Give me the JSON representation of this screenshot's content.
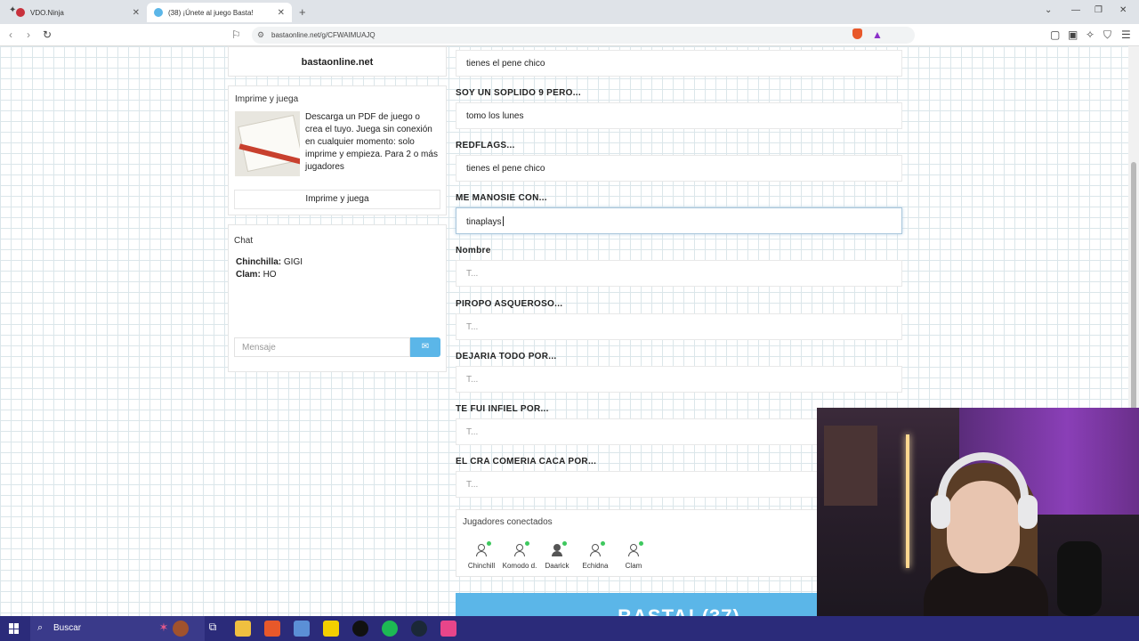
{
  "browser": {
    "tabs": [
      {
        "title": "VDO.Ninja",
        "active": false
      },
      {
        "title": "(38) ¡Únete al juego Basta!",
        "active": true
      }
    ],
    "url": "bastaonline.net/g/CFWAIMUAJQ"
  },
  "sidebar": {
    "site_title": "bastaonline.net",
    "print": {
      "heading": "Imprime y juega",
      "description": "Descarga un PDF de juego o crea el tuyo. Juega sin conexión en cualquier momento: solo imprime y empieza. Para 2 o más jugadores",
      "button": "Imprime y juega"
    },
    "chat": {
      "heading": "Chat",
      "messages": [
        {
          "user": "Chinchilla:",
          "text": "GIGI"
        },
        {
          "user": "Clam:",
          "text": "HO"
        }
      ],
      "input_placeholder": "Mensaje"
    }
  },
  "form": {
    "first_value": "tienes el pene chico",
    "fields": [
      {
        "label": "SOY UN SOPLIDO 9 PERO...",
        "value": "tomo los lunes"
      },
      {
        "label": "REDFLAGS...",
        "value": "tienes el pene  chico"
      },
      {
        "label": "ME MANOSIE CON...",
        "value": "tinaplays"
      },
      {
        "label": "Nombre",
        "value": "T..."
      },
      {
        "label": "PIROPO ASQUEROSO...",
        "value": "T..."
      },
      {
        "label": "DEJARIA TODO POR...",
        "value": "T..."
      },
      {
        "label": "TE FUI INFIEL POR...",
        "value": "T..."
      },
      {
        "label": "EL CRA COMERIA CACA POR...",
        "value": "T..."
      }
    ]
  },
  "players": {
    "heading": "Jugadores conectados",
    "list": [
      "Chinchill",
      "Komodo d.",
      "Daarick",
      "Echidna",
      "Clam"
    ],
    "status_color": "#3ec85e"
  },
  "basta_button": "BASTA! (37)",
  "taskbar": {
    "search_label": "Buscar"
  },
  "colors": {
    "accent": "#5bb6e8",
    "taskbar": "#2b2b7a"
  }
}
